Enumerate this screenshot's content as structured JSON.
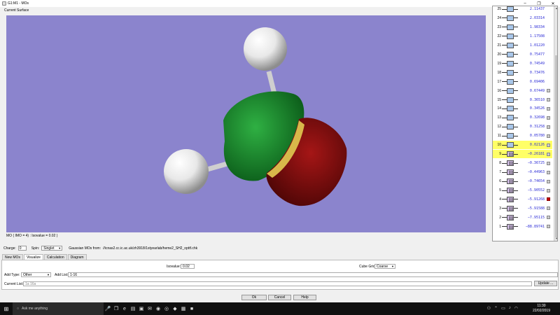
{
  "window": {
    "title": "G1:M1 - MOs",
    "min": "–",
    "max": "❐",
    "close": "✕"
  },
  "surface_label": "Current Surface",
  "mo_info": "MO ( IMO = 4) : Isovalue = 0.02 )",
  "mo_list": [
    {
      "n": "25",
      "e": "2.11437",
      "occ": false,
      "hl": false,
      "chk": ""
    },
    {
      "n": "24",
      "e": "2.03314",
      "occ": false,
      "hl": false,
      "chk": ""
    },
    {
      "n": "23",
      "e": "1.98334",
      "occ": false,
      "hl": false,
      "chk": ""
    },
    {
      "n": "22",
      "e": "1.17508",
      "occ": false,
      "hl": false,
      "chk": ""
    },
    {
      "n": "21",
      "e": "1.01220",
      "occ": false,
      "hl": false,
      "chk": ""
    },
    {
      "n": "20",
      "e": "0.75477",
      "occ": false,
      "hl": false,
      "chk": ""
    },
    {
      "n": "19",
      "e": "0.74549",
      "occ": false,
      "hl": false,
      "chk": ""
    },
    {
      "n": "18",
      "e": "0.73476",
      "occ": false,
      "hl": false,
      "chk": ""
    },
    {
      "n": "17",
      "e": "0.69406",
      "occ": false,
      "hl": false,
      "chk": ""
    },
    {
      "n": "16",
      "e": "0.67449",
      "occ": false,
      "hl": false,
      "chk": "grey"
    },
    {
      "n": "15",
      "e": "0.36510",
      "occ": false,
      "hl": false,
      "chk": "grey"
    },
    {
      "n": "14",
      "e": "0.34526",
      "occ": false,
      "hl": false,
      "chk": "grey"
    },
    {
      "n": "13",
      "e": "0.32698",
      "occ": false,
      "hl": false,
      "chk": "grey"
    },
    {
      "n": "12",
      "e": "0.31258",
      "occ": false,
      "hl": false,
      "chk": "grey"
    },
    {
      "n": "11",
      "e": "0.05780",
      "occ": false,
      "hl": false,
      "chk": "grey"
    },
    {
      "n": "10",
      "e": "0.02126",
      "occ": false,
      "hl": true,
      "chk": "grey"
    },
    {
      "n": "9",
      "e": "−0.26181",
      "occ": true,
      "hl": true,
      "chk": "grey"
    },
    {
      "n": "8",
      "e": "−0.36725",
      "occ": true,
      "hl": false,
      "chk": "grey"
    },
    {
      "n": "7",
      "e": "−0.44963",
      "occ": true,
      "hl": false,
      "chk": "grey"
    },
    {
      "n": "6",
      "e": "−0.74654",
      "occ": true,
      "hl": false,
      "chk": "grey"
    },
    {
      "n": "5",
      "e": "−5.90552",
      "occ": true,
      "hl": false,
      "chk": "grey"
    },
    {
      "n": "4",
      "e": "−5.91268",
      "occ": true,
      "hl": false,
      "chk": "red"
    },
    {
      "n": "3",
      "e": "−5.91588",
      "occ": true,
      "hl": false,
      "chk": "grey"
    },
    {
      "n": "2",
      "e": "−7.95115",
      "occ": true,
      "hl": false,
      "chk": "grey"
    },
    {
      "n": "1",
      "e": "−88.89741",
      "occ": true,
      "hl": false,
      "chk": "grey"
    }
  ],
  "charge_row": {
    "charge_label": "Charge:",
    "charge_value": "0",
    "spin_label": "Spin:",
    "spin_value": "Singlet",
    "source_label": "Gaussian MOs from:",
    "source_path": "//icnas2.cc.ic.ac.uk/zh3918/1styearlab/heme2_SH2_opttf.chk"
  },
  "tabs": [
    "New MOs",
    "Visualize",
    "Calculation",
    "Diagram"
  ],
  "active_tab": "Visualize",
  "visualize": {
    "isovalue_label": "Isovalue:",
    "isovalue": "0.02",
    "cube_grid_label": "Cube Grid:",
    "cube_grid": "Coarse",
    "add_type_label": "Add Type:",
    "add_type": "Other",
    "add_list_label": "Add List:",
    "add_list": "1-16",
    "current_list_label": "Current List:",
    "current_list": "1a 16a",
    "update_btn": "Update ..."
  },
  "buttons": {
    "ok": "Ok",
    "cancel": "Cancel",
    "help": "Help"
  },
  "taskbar": {
    "search_placeholder": "Ask me anything",
    "time": "11:30",
    "date": "22/02/2019"
  }
}
